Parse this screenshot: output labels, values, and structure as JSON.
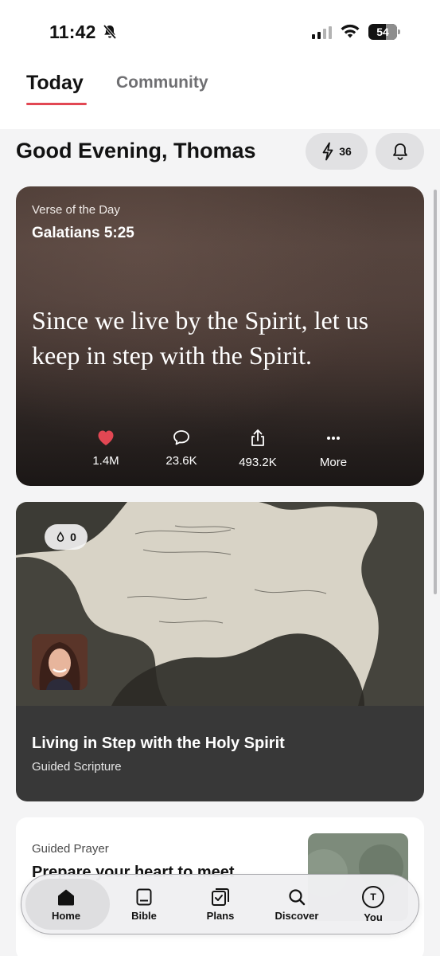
{
  "status_bar": {
    "time": "11:42",
    "battery": "54",
    "icons": [
      "bell-slash-icon",
      "cellular-signal-icon",
      "wifi-icon",
      "battery-icon"
    ]
  },
  "header": {
    "tabs": [
      {
        "label": "Today",
        "active": true
      },
      {
        "label": "Community",
        "active": false
      }
    ],
    "accent_color": "#e24753"
  },
  "greeting": {
    "text": "Good Evening, Thomas",
    "streak_count": "36"
  },
  "verse_of_day": {
    "label": "Verse of the Day",
    "reference": "Galatians 5:25",
    "text": "Since we live by the Spirit, let us keep in step with the Spirit.",
    "actions": [
      {
        "icon": "heart-icon",
        "label": "1.4M"
      },
      {
        "icon": "comment-icon",
        "label": "23.6K"
      },
      {
        "icon": "share-icon",
        "label": "493.2K"
      },
      {
        "icon": "more-icon",
        "label": "More"
      }
    ],
    "like_color": "#e24753"
  },
  "guided_scripture": {
    "drop_count": "0",
    "title": "Living in Step with the Holy Spirit",
    "subtitle": "Guided Scripture"
  },
  "guided_prayer": {
    "label": "Guided Prayer",
    "title": "Prepare your heart to meet"
  },
  "bottom_nav": {
    "items": [
      {
        "label": "Home",
        "icon": "home-icon",
        "active": true
      },
      {
        "label": "Bible",
        "icon": "bible-icon",
        "active": false
      },
      {
        "label": "Plans",
        "icon": "plans-icon",
        "active": false
      },
      {
        "label": "Discover",
        "icon": "search-icon",
        "active": false
      },
      {
        "label": "You",
        "icon": "avatar-icon",
        "active": false,
        "initial": "T"
      }
    ]
  }
}
